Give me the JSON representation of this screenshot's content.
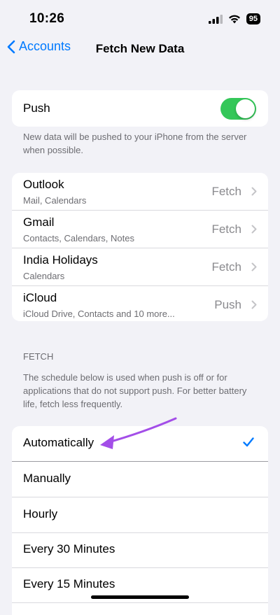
{
  "status_bar": {
    "time": "10:26",
    "battery": "95"
  },
  "nav": {
    "back_label": "Accounts",
    "title": "Fetch New Data"
  },
  "push": {
    "label": "Push",
    "enabled": true,
    "note": "New data will be pushed to your iPhone from the server when possible."
  },
  "accounts": [
    {
      "name": "Outlook",
      "detail": "Mail, Calendars",
      "value": "Fetch"
    },
    {
      "name": "Gmail",
      "detail": "Contacts, Calendars, Notes",
      "value": "Fetch"
    },
    {
      "name": "India Holidays",
      "detail": "Calendars",
      "value": "Fetch"
    },
    {
      "name": "iCloud",
      "detail": "iCloud Drive, Contacts and 10 more...",
      "value": "Push"
    }
  ],
  "fetch": {
    "header": "FETCH",
    "note": "The schedule below is used when push is off or for applications that do not support push. For better battery life, fetch less frequently.",
    "options": [
      "Automatically",
      "Manually",
      "Hourly",
      "Every 30 Minutes",
      "Every 15 Minutes"
    ],
    "selected": "Automatically"
  },
  "colors": {
    "accent": "#007aff",
    "toggle_on": "#34c759",
    "annotation": "#a34ee8"
  }
}
